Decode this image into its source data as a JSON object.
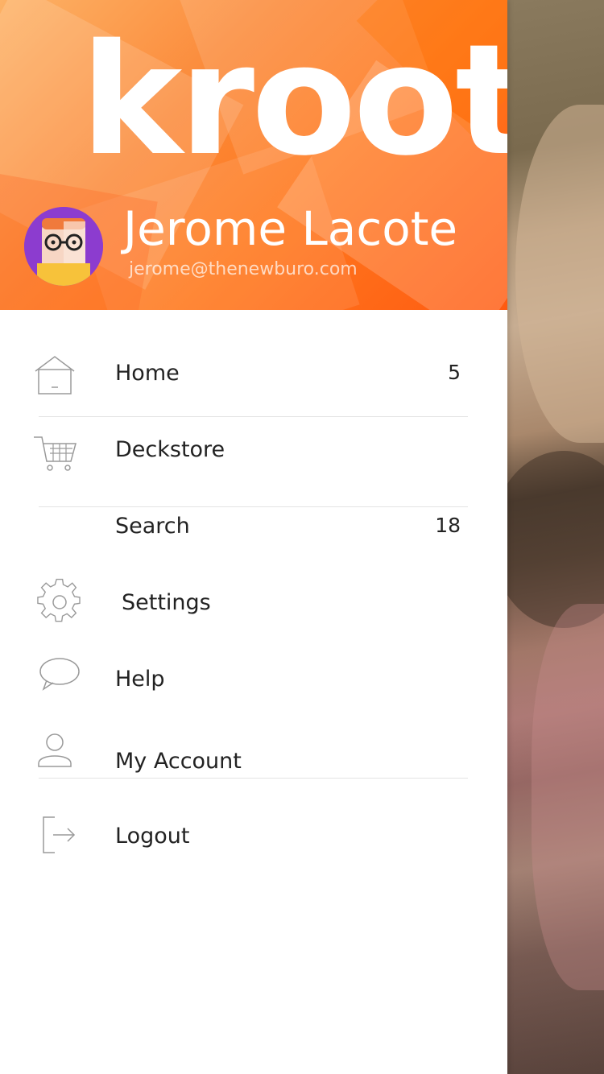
{
  "app": {
    "logo_text": "kroot",
    "accent_color": "#ff7a20"
  },
  "user": {
    "name": "Jerome Lacote",
    "email": "jerome@thenewburo.com"
  },
  "menu": {
    "items": [
      {
        "label": "Home",
        "count": "5",
        "icon": "home-icon"
      },
      {
        "label": "Deckstore",
        "count": "",
        "icon": "cart-icon"
      },
      {
        "label": "Search",
        "count": "18",
        "icon": ""
      },
      {
        "label": "Settings",
        "count": "",
        "icon": "gear-icon"
      },
      {
        "label": "Help",
        "count": "",
        "icon": "speech-bubble-icon"
      },
      {
        "label": "My Account",
        "count": "",
        "icon": "user-icon"
      },
      {
        "label": "Logout",
        "count": "",
        "icon": "logout-icon"
      }
    ]
  }
}
